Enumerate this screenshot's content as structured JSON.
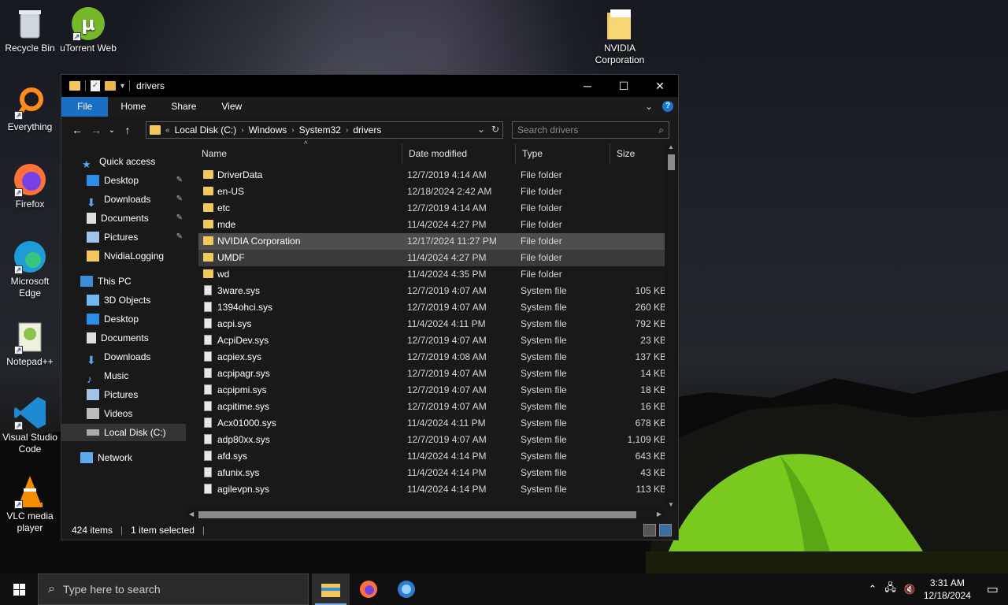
{
  "desktop": {
    "icons": [
      {
        "label": "Recycle Bin",
        "icon": "recycle-bin-icon"
      },
      {
        "label": "uTorrent Web",
        "icon": "utorrent-icon"
      },
      {
        "label": "NVIDIA Corporation",
        "icon": "folder-icon"
      },
      {
        "label": "Everything",
        "icon": "everything-search-icon"
      },
      {
        "label": "Firefox",
        "icon": "firefox-icon"
      },
      {
        "label": "Microsoft Edge",
        "icon": "edge-icon"
      },
      {
        "label": "Notepad++",
        "icon": "notepadpp-icon"
      },
      {
        "label": "Visual Studio Code",
        "icon": "vscode-icon"
      },
      {
        "label": "VLC media player",
        "icon": "vlc-icon"
      }
    ]
  },
  "window": {
    "title": "drivers",
    "controls": {
      "minimize": "─",
      "maximize": "☐",
      "close": "✕"
    },
    "ribbon_tabs": [
      "File",
      "Home",
      "Share",
      "View"
    ],
    "ribbon_expand": "⌄",
    "help": "?",
    "nav": {
      "back": "←",
      "forward": "→",
      "recent": "⌄",
      "up": "↑"
    },
    "address": {
      "overflow": "«",
      "crumbs": [
        "Local Disk (C:)",
        "Windows",
        "System32",
        "drivers"
      ],
      "separator": "›",
      "dropdown": "⌄",
      "refresh": "↻"
    },
    "search": {
      "placeholder": "Search drivers",
      "icon": "⌕"
    },
    "navpane": {
      "quick_access": "Quick access",
      "quick_items": [
        "Desktop",
        "Downloads",
        "Documents",
        "Pictures",
        "NvidiaLogging"
      ],
      "pin": "📌",
      "this_pc": "This PC",
      "pc_items": [
        "3D Objects",
        "Desktop",
        "Documents",
        "Downloads",
        "Music",
        "Pictures",
        "Videos",
        "Local Disk (C:)"
      ],
      "network": "Network"
    },
    "columns": {
      "name": "Name",
      "date": "Date modified",
      "type": "Type",
      "size": "Size",
      "sort_indicator": "^"
    },
    "files": [
      {
        "name": "DriverData",
        "date": "12/7/2019 4:14 AM",
        "type": "File folder",
        "size": "",
        "kind": "folder"
      },
      {
        "name": "en-US",
        "date": "12/18/2024 2:42 AM",
        "type": "File folder",
        "size": "",
        "kind": "folder"
      },
      {
        "name": "etc",
        "date": "12/7/2019 4:14 AM",
        "type": "File folder",
        "size": "",
        "kind": "folder"
      },
      {
        "name": "mde",
        "date": "11/4/2024 4:27 PM",
        "type": "File folder",
        "size": "",
        "kind": "folder"
      },
      {
        "name": "NVIDIA Corporation",
        "date": "12/17/2024 11:27 PM",
        "type": "File folder",
        "size": "",
        "kind": "folder"
      },
      {
        "name": "UMDF",
        "date": "11/4/2024 4:27 PM",
        "type": "File folder",
        "size": "",
        "kind": "folder"
      },
      {
        "name": "wd",
        "date": "11/4/2024 4:35 PM",
        "type": "File folder",
        "size": "",
        "kind": "folder"
      },
      {
        "name": "3ware.sys",
        "date": "12/7/2019 4:07 AM",
        "type": "System file",
        "size": "105 KB",
        "kind": "sys"
      },
      {
        "name": "1394ohci.sys",
        "date": "12/7/2019 4:07 AM",
        "type": "System file",
        "size": "260 KB",
        "kind": "sys"
      },
      {
        "name": "acpi.sys",
        "date": "11/4/2024 4:11 PM",
        "type": "System file",
        "size": "792 KB",
        "kind": "sys"
      },
      {
        "name": "AcpiDev.sys",
        "date": "12/7/2019 4:07 AM",
        "type": "System file",
        "size": "23 KB",
        "kind": "sys"
      },
      {
        "name": "acpiex.sys",
        "date": "12/7/2019 4:08 AM",
        "type": "System file",
        "size": "137 KB",
        "kind": "sys"
      },
      {
        "name": "acpipagr.sys",
        "date": "12/7/2019 4:07 AM",
        "type": "System file",
        "size": "14 KB",
        "kind": "sys"
      },
      {
        "name": "acpipmi.sys",
        "date": "12/7/2019 4:07 AM",
        "type": "System file",
        "size": "18 KB",
        "kind": "sys"
      },
      {
        "name": "acpitime.sys",
        "date": "12/7/2019 4:07 AM",
        "type": "System file",
        "size": "16 KB",
        "kind": "sys"
      },
      {
        "name": "Acx01000.sys",
        "date": "11/4/2024 4:11 PM",
        "type": "System file",
        "size": "678 KB",
        "kind": "sys"
      },
      {
        "name": "adp80xx.sys",
        "date": "12/7/2019 4:07 AM",
        "type": "System file",
        "size": "1,109 KB",
        "kind": "sys"
      },
      {
        "name": "afd.sys",
        "date": "11/4/2024 4:14 PM",
        "type": "System file",
        "size": "643 KB",
        "kind": "sys"
      },
      {
        "name": "afunix.sys",
        "date": "11/4/2024 4:14 PM",
        "type": "System file",
        "size": "43 KB",
        "kind": "sys"
      },
      {
        "name": "agilevpn.sys",
        "date": "11/4/2024 4:14 PM",
        "type": "System file",
        "size": "113 KB",
        "kind": "sys"
      }
    ],
    "selected_row": 4,
    "hover_row": 5,
    "status": {
      "count": "424 items",
      "selected": "1 item selected"
    }
  },
  "taskbar": {
    "search_placeholder": "Type here to search",
    "apps": [
      "file-explorer-icon",
      "firefox-icon",
      "edge-beta-icon"
    ],
    "tray": {
      "chevron": "⌃",
      "time": "3:31 AM",
      "date": "12/18/2024",
      "notifications": "▭"
    }
  },
  "colors": {
    "accent": "#1a6fc2",
    "folder": "#f3c85b",
    "selection": "#4d4d4d"
  }
}
